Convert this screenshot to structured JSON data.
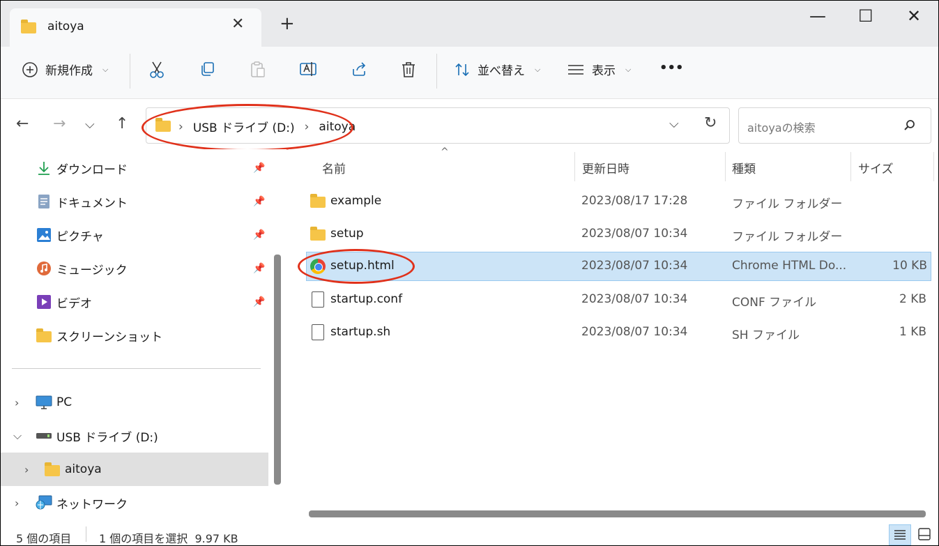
{
  "window": {
    "tab_title": "aitoya",
    "tab_close": "✕",
    "new_tab": "+",
    "minimize": "—",
    "maximize": "☐",
    "close": "✕"
  },
  "toolbar": {
    "new_label": "新規作成",
    "sort_label": "並べ替え",
    "view_label": "表示",
    "more_label": "•••"
  },
  "nav": {
    "breadcrumb": [
      "USB ドライブ (D:)",
      "aitoya"
    ],
    "search_placeholder": "aitoyaの検索"
  },
  "sidebar": {
    "quick_access": [
      {
        "label": "ダウンロード",
        "icon": "download-icon"
      },
      {
        "label": "ドキュメント",
        "icon": "documents-icon"
      },
      {
        "label": "ピクチャ",
        "icon": "pictures-icon"
      },
      {
        "label": "ミュージック",
        "icon": "music-icon"
      },
      {
        "label": "ビデオ",
        "icon": "videos-icon"
      },
      {
        "label": "スクリーンショット",
        "icon": "folder-icon"
      }
    ],
    "tree": [
      {
        "label": "PC",
        "icon": "pc-icon"
      },
      {
        "label": "USB ドライブ (D:)",
        "icon": "usb-drive-icon"
      },
      {
        "label": "aitoya",
        "icon": "folder-icon"
      },
      {
        "label": "ネットワーク",
        "icon": "network-icon"
      }
    ]
  },
  "columns": {
    "name": "名前",
    "modified": "更新日時",
    "type": "種類",
    "size": "サイズ"
  },
  "files": [
    {
      "name": "example",
      "modified": "2023/08/17 17:28",
      "type": "ファイル フォルダー",
      "size": "",
      "icon": "folder-icon"
    },
    {
      "name": "setup",
      "modified": "2023/08/07 10:34",
      "type": "ファイル フォルダー",
      "size": "",
      "icon": "folder-icon"
    },
    {
      "name": "setup.html",
      "modified": "2023/08/07 10:34",
      "type": "Chrome HTML Do...",
      "size": "10 KB",
      "icon": "chrome-icon"
    },
    {
      "name": "startup.conf",
      "modified": "2023/08/07 10:34",
      "type": "CONF ファイル",
      "size": "2 KB",
      "icon": "file-icon"
    },
    {
      "name": "startup.sh",
      "modified": "2023/08/07 10:34",
      "type": "SH ファイル",
      "size": "1 KB",
      "icon": "file-icon"
    }
  ],
  "status": {
    "count": "5 個の項目",
    "selection": "1 個の項目を選択  9.97 KB"
  },
  "colors": {
    "accent": "#0067c0",
    "selected_row": "#cce4f7",
    "annotation_red": "#e0311b"
  }
}
